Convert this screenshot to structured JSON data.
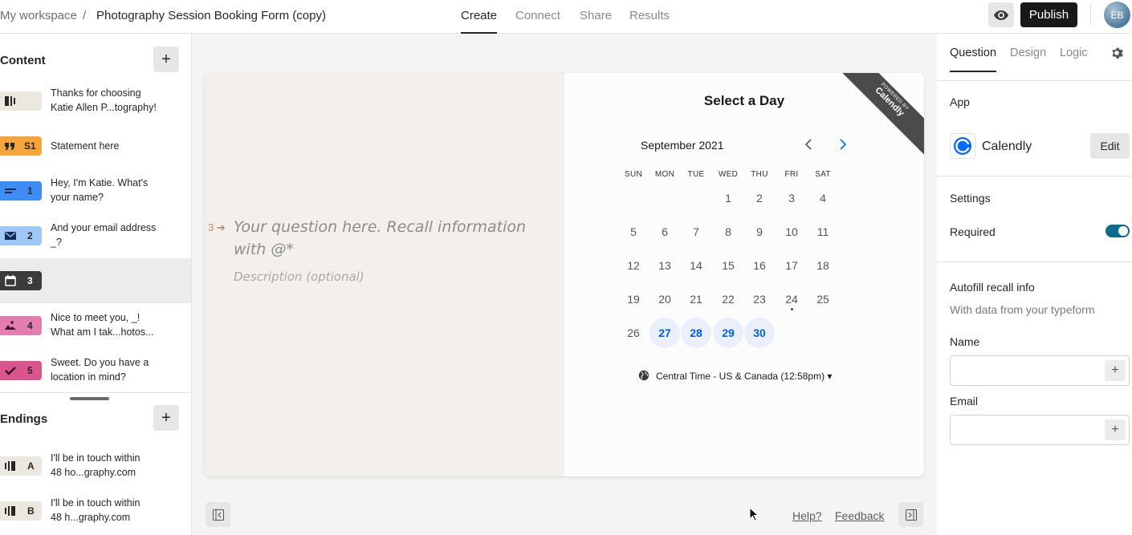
{
  "topbar": {
    "workspace": "My workspace",
    "separator": "/",
    "form_title": "Photography Session Booking Form (copy)",
    "tabs": [
      "Create",
      "Connect",
      "Share",
      "Results"
    ],
    "active_tab": "Create",
    "publish_label": "Publish",
    "avatar_initials": "EB"
  },
  "sidebar": {
    "content_title": "Content",
    "add_label": "+",
    "items": [
      {
        "text1": "Thanks for choosing",
        "text2": "Katie Allen P...tography!",
        "num": "",
        "color": "#ece8df",
        "icon": "welcome-screen-icon"
      },
      {
        "text1": "Statement here",
        "text2": "",
        "num": "S1",
        "color": "#f5a53b",
        "icon": "quote-icon"
      },
      {
        "text1": "Hey, I'm Katie. What's",
        "text2": "your name?",
        "num": "1",
        "color": "#3d8df5",
        "icon": "short-text-icon"
      },
      {
        "text1": "And your email address",
        "text2": "_?",
        "num": "2",
        "color": "#9ec8f5",
        "icon": "email-icon"
      },
      {
        "text1": "",
        "text2": "",
        "num": "3",
        "color": "#3a3a3a",
        "icon": "calendar-icon"
      },
      {
        "text1": "Nice to meet you, _!",
        "text2": "What am I tak...hotos...",
        "num": "4",
        "color": "#e27fb0",
        "icon": "picture-choice-icon"
      },
      {
        "text1": "Sweet. Do you have a",
        "text2": "location in mind?",
        "num": "5",
        "color": "#d9568d",
        "icon": "checkmark-icon"
      }
    ],
    "endings_title": "Endings",
    "endings": [
      {
        "text1": "I'll be in touch within",
        "text2": "48 ho...graphy.com",
        "letter": "A"
      },
      {
        "text1": "I'll be in touch within",
        "text2": "48 h...graphy.com",
        "letter": "B"
      }
    ]
  },
  "question": {
    "number": "3",
    "arrow": "➔",
    "title": "Your question here. Recall information with @*",
    "description": "Description (optional)"
  },
  "calendly": {
    "heading": "Select a Day",
    "ribbon_small": "POWERED BY",
    "ribbon_big": "Calendly",
    "month": "September 2021",
    "weekdays": [
      "SUN",
      "MON",
      "TUE",
      "WED",
      "THU",
      "FRI",
      "SAT"
    ],
    "weeks": [
      [
        "",
        "",
        "",
        "1",
        "2",
        "3",
        "4"
      ],
      [
        "5",
        "6",
        "7",
        "8",
        "9",
        "10",
        "11"
      ],
      [
        "12",
        "13",
        "14",
        "15",
        "16",
        "17",
        "18"
      ],
      [
        "19",
        "20",
        "21",
        "22",
        "23",
        "24",
        "25"
      ],
      [
        "26",
        "27",
        "28",
        "29",
        "30",
        "",
        ""
      ]
    ],
    "available_days": [
      "27",
      "28",
      "29",
      "30"
    ],
    "today": "24",
    "timezone": "Central Time - US & Canada (12:58pm) ▾"
  },
  "footer": {
    "help": "Help?",
    "feedback": "Feedback"
  },
  "panel": {
    "tabs": [
      "Question",
      "Design",
      "Logic"
    ],
    "active_tab": "Question",
    "app_label": "App",
    "app_name": "Calendly",
    "edit_label": "Edit",
    "settings_label": "Settings",
    "required_label": "Required",
    "required": true,
    "autofill_title": "Autofill recall info",
    "autofill_sub": "With data from your typeform",
    "name_label": "Name",
    "email_label": "Email"
  }
}
